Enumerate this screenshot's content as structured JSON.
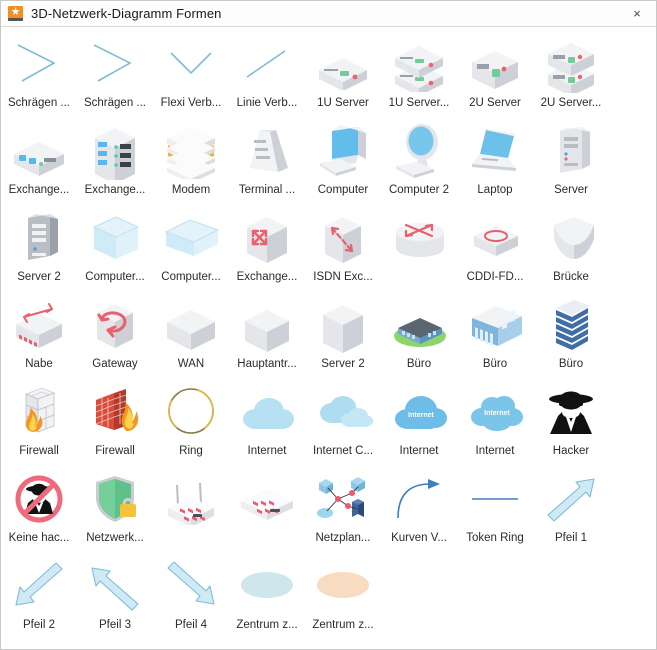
{
  "window": {
    "title": "3D-Netzwerk-Diagramm Formen",
    "app_icon": "star-icon",
    "close_label": "×",
    "accent_color": "#f0911e",
    "connector_color": "#7fbcd6",
    "accent_red": "#e8616e",
    "accent_blue": "#5bb3e4"
  },
  "shapes": [
    {
      "label": "Schrägen ...",
      "icon": "zigzag-connector-1-icon"
    },
    {
      "label": "Schrägen ...",
      "icon": "zigzag-connector-2-icon"
    },
    {
      "label": "Flexi Verb...",
      "icon": "flexible-connector-icon"
    },
    {
      "label": "Linie Verb...",
      "icon": "line-connector-icon"
    },
    {
      "label": "1U Server",
      "icon": "rack-server-1u-icon"
    },
    {
      "label": "1U Server...",
      "icon": "rack-server-1u-stack-icon"
    },
    {
      "label": "2U Server",
      "icon": "rack-server-2u-icon"
    },
    {
      "label": "2U Server...",
      "icon": "rack-server-2u-stack-icon"
    },
    {
      "label": "Exchange...",
      "icon": "exchange-unit-icon"
    },
    {
      "label": "Exchange...",
      "icon": "exchange-rack-icon"
    },
    {
      "label": "Modem",
      "icon": "modem-icon"
    },
    {
      "label": "Terminal ...",
      "icon": "terminal-tower-icon"
    },
    {
      "label": "Computer",
      "icon": "crt-computer-icon"
    },
    {
      "label": "Computer 2",
      "icon": "lcd-computer-icon"
    },
    {
      "label": "Laptop",
      "icon": "laptop-icon"
    },
    {
      "label": "Server",
      "icon": "tower-server-icon"
    },
    {
      "label": "Server 2",
      "icon": "tower-server-2-icon"
    },
    {
      "label": "Computer...",
      "icon": "open-box-tall-icon"
    },
    {
      "label": "Computer...",
      "icon": "open-box-wide-icon"
    },
    {
      "label": "Exchange...",
      "icon": "exchange-switch-arrows-icon"
    },
    {
      "label": "ISDN Exc...",
      "icon": "isdn-exchange-icon"
    },
    {
      "label": "",
      "icon": "router-cylinder-icon"
    },
    {
      "label": "CDDI-FD...",
      "icon": "cddi-fddi-ring-icon"
    },
    {
      "label": "Brücke",
      "icon": "bridge-icon"
    },
    {
      "label": "Nabe",
      "icon": "hub-icon"
    },
    {
      "label": "Gateway",
      "icon": "gateway-icon"
    },
    {
      "label": "WAN",
      "icon": "wan-box-icon"
    },
    {
      "label": "Hauptantr...",
      "icon": "main-drive-box-icon"
    },
    {
      "label": "Server 2",
      "icon": "server-box-icon"
    },
    {
      "label": "Büro",
      "icon": "office-campus-icon"
    },
    {
      "label": "Büro",
      "icon": "office-building-icon"
    },
    {
      "label": "Büro",
      "icon": "office-tower-icon"
    },
    {
      "label": "Firewall",
      "icon": "firewall-wall-icon"
    },
    {
      "label": "Firewall",
      "icon": "firewall-brick-icon"
    },
    {
      "label": "Ring",
      "icon": "ring-icon"
    },
    {
      "label": "Internet",
      "icon": "cloud-icon"
    },
    {
      "label": "Internet C...",
      "icon": "cloud-double-icon"
    },
    {
      "label": "Internet",
      "icon": "cloud-label-internet-icon"
    },
    {
      "label": "Internet",
      "icon": "cloud-bumpy-internet-icon"
    },
    {
      "label": "Hacker",
      "icon": "hacker-icon"
    },
    {
      "label": "Keine hac...",
      "icon": "no-hacker-icon"
    },
    {
      "label": "Netzwerk...",
      "icon": "shield-lock-icon"
    },
    {
      "label": "",
      "icon": "wireless-router-icon"
    },
    {
      "label": "",
      "icon": "network-switch-icon"
    },
    {
      "label": "Netzplan...",
      "icon": "network-diagram-icon"
    },
    {
      "label": "Kurven V...",
      "icon": "curved-connector-icon"
    },
    {
      "label": "Token Ring",
      "icon": "token-ring-line-icon"
    },
    {
      "label": "Pfeil 1",
      "icon": "arrow-up-right-icon"
    },
    {
      "label": "Pfeil 2",
      "icon": "arrow-down-left-icon"
    },
    {
      "label": "Pfeil 3",
      "icon": "arrow-up-left-icon"
    },
    {
      "label": "Pfeil 4",
      "icon": "arrow-down-right-icon"
    },
    {
      "label": "Zentrum z...",
      "icon": "ellipse-blue-icon"
    },
    {
      "label": "Zentrum z...",
      "icon": "ellipse-orange-icon"
    }
  ]
}
